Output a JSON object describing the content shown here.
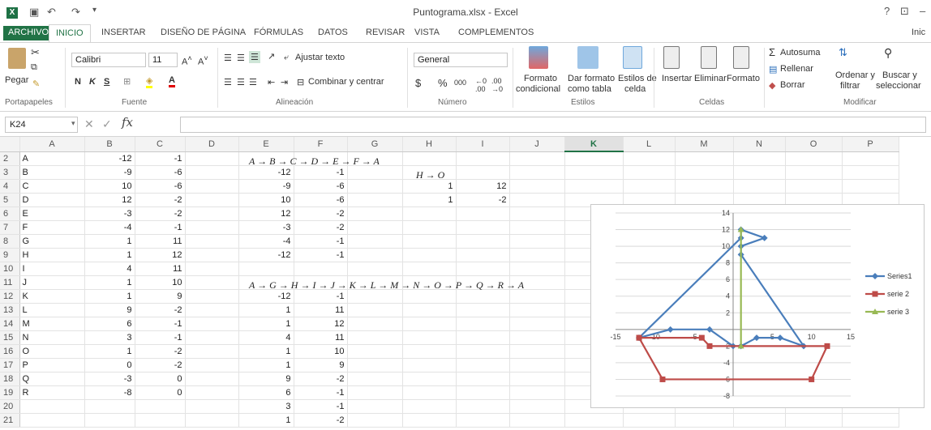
{
  "window": {
    "title": "Puntograma.xlsx - Excel",
    "help": "?",
    "minimize": "–"
  },
  "tabs": [
    "ARCHIVO",
    "INICIO",
    "INSERTAR",
    "DISEÑO DE PÁGINA",
    "FÓRMULAS",
    "DATOS",
    "REVISAR",
    "VISTA",
    "COMPLEMENTOS"
  ],
  "account": "Inic",
  "ribbon": {
    "clipboard": {
      "paste": "Pegar",
      "group": "Portapapeles"
    },
    "font": {
      "name": "Calibri",
      "size": "11",
      "bold": "N",
      "italic": "K",
      "underline": "S",
      "group": "Fuente"
    },
    "alignment": {
      "wrap": "Ajustar texto",
      "merge": "Combinar y centrar",
      "group": "Alineación"
    },
    "number": {
      "format": "General",
      "currency": "$",
      "percent": "%",
      "thousands": "000",
      "inc": "⁺⁰₀₀",
      "dec": "⁰₀",
      "group": "Número"
    },
    "styles": {
      "conditional": "Formato",
      "conditional2": "condicional",
      "table": "Dar formato",
      "table2": "como tabla",
      "cell": "Estilos de",
      "cell2": "celda",
      "group": "Estilos"
    },
    "cells": {
      "insert": "Insertar",
      "delete": "Eliminar",
      "format": "Formato",
      "group": "Celdas"
    },
    "editing": {
      "autosum": "Autosuma",
      "fill": "Rellenar",
      "clear": "Borrar",
      "sort": "Ordenar y",
      "sort2": "filtrar",
      "find": "Buscar y",
      "find2": "seleccionar",
      "group": "Modificar"
    }
  },
  "formula_bar": {
    "name_box": "K24",
    "fx": "fx",
    "value": ""
  },
  "columns": [
    "A",
    "B",
    "C",
    "D",
    "E",
    "F",
    "G",
    "H",
    "I",
    "J",
    "K",
    "L",
    "M",
    "N",
    "O",
    "P"
  ],
  "rows": [
    {
      "n": "2",
      "A": "A",
      "B": "-12",
      "C": "-1",
      "E": "",
      "F": "",
      "H": "",
      "I": ""
    },
    {
      "n": "3",
      "A": "B",
      "B": "-9",
      "C": "-6",
      "E": "-12",
      "F": "-1",
      "H": "",
      "I": ""
    },
    {
      "n": "4",
      "A": "C",
      "B": "10",
      "C": "-6",
      "E": "-9",
      "F": "-6",
      "H": "1",
      "I": "12"
    },
    {
      "n": "5",
      "A": "D",
      "B": "12",
      "C": "-2",
      "E": "10",
      "F": "-6",
      "H": "1",
      "I": "-2"
    },
    {
      "n": "6",
      "A": "E",
      "B": "-3",
      "C": "-2",
      "E": "12",
      "F": "-2",
      "H": "",
      "I": ""
    },
    {
      "n": "7",
      "A": "F",
      "B": "-4",
      "C": "-1",
      "E": "-3",
      "F": "-2",
      "H": "",
      "I": ""
    },
    {
      "n": "8",
      "A": "G",
      "B": "1",
      "C": "11",
      "E": "-4",
      "F": "-1",
      "H": "",
      "I": ""
    },
    {
      "n": "9",
      "A": "H",
      "B": "1",
      "C": "12",
      "E": "-12",
      "F": "-1",
      "H": "",
      "I": ""
    },
    {
      "n": "10",
      "A": "I",
      "B": "4",
      "C": "11",
      "E": "",
      "F": "",
      "H": "",
      "I": ""
    },
    {
      "n": "11",
      "A": "J",
      "B": "1",
      "C": "10",
      "E": "",
      "F": "",
      "H": "",
      "I": ""
    },
    {
      "n": "12",
      "A": "K",
      "B": "1",
      "C": "9",
      "E": "-12",
      "F": "-1",
      "H": "",
      "I": ""
    },
    {
      "n": "13",
      "A": "L",
      "B": "9",
      "C": "-2",
      "E": "1",
      "F": "11",
      "H": "",
      "I": ""
    },
    {
      "n": "14",
      "A": "M",
      "B": "6",
      "C": "-1",
      "E": "1",
      "F": "12",
      "H": "",
      "I": ""
    },
    {
      "n": "15",
      "A": "N",
      "B": "3",
      "C": "-1",
      "E": "4",
      "F": "11",
      "H": "",
      "I": ""
    },
    {
      "n": "16",
      "A": "O",
      "B": "1",
      "C": "-2",
      "E": "1",
      "F": "10",
      "H": "",
      "I": ""
    },
    {
      "n": "17",
      "A": "P",
      "B": "0",
      "C": "-2",
      "E": "1",
      "F": "9",
      "H": "",
      "I": ""
    },
    {
      "n": "18",
      "A": "Q",
      "B": "-3",
      "C": "0",
      "E": "9",
      "F": "-2",
      "H": "",
      "I": ""
    },
    {
      "n": "19",
      "A": "R",
      "B": "-8",
      "C": "0",
      "E": "6",
      "F": "-1",
      "H": "",
      "I": ""
    },
    {
      "n": "20",
      "A": "",
      "B": "",
      "C": "",
      "E": "3",
      "F": "-1",
      "H": "",
      "I": ""
    },
    {
      "n": "21",
      "A": "",
      "B": "",
      "C": "",
      "E": "1",
      "F": "-2",
      "H": "",
      "I": ""
    }
  ],
  "overlays": {
    "e2": "A → B → C → D → E → F → A",
    "h3": "H → O",
    "e11": "A → G → H → I → J → K → L → M → N → O → P → Q → R → A"
  },
  "chart_data": {
    "type": "scatter",
    "xlim": [
      -15,
      15
    ],
    "ylim": [
      -8,
      14
    ],
    "xticks": [
      "-15",
      "-10",
      "-5",
      "0",
      "5",
      "10",
      "15"
    ],
    "yticks": [
      "-8",
      "-6",
      "-4",
      "-2",
      "0",
      "2",
      "4",
      "6",
      "8",
      "10",
      "12",
      "14"
    ],
    "legend_position": "right",
    "series": [
      {
        "name": "Series1",
        "color": "#4a7ebb",
        "marker": "diamond",
        "x": [
          -12,
          1,
          1,
          4,
          1,
          1,
          9,
          6,
          3,
          1,
          0,
          -3,
          -8,
          -12
        ],
        "y": [
          -1,
          11,
          12,
          11,
          10,
          9,
          -2,
          -1,
          -1,
          -2,
          -2,
          0,
          0,
          -1
        ]
      },
      {
        "name": "serie 2",
        "color": "#be4b48",
        "marker": "square",
        "x": [
          -12,
          -9,
          10,
          12,
          -3,
          -4,
          -12
        ],
        "y": [
          -1,
          -6,
          -6,
          -2,
          -2,
          -1,
          -1
        ]
      },
      {
        "name": "serie 3",
        "color": "#98b954",
        "marker": "triangle",
        "x": [
          1,
          1
        ],
        "y": [
          12,
          -2
        ]
      }
    ]
  }
}
